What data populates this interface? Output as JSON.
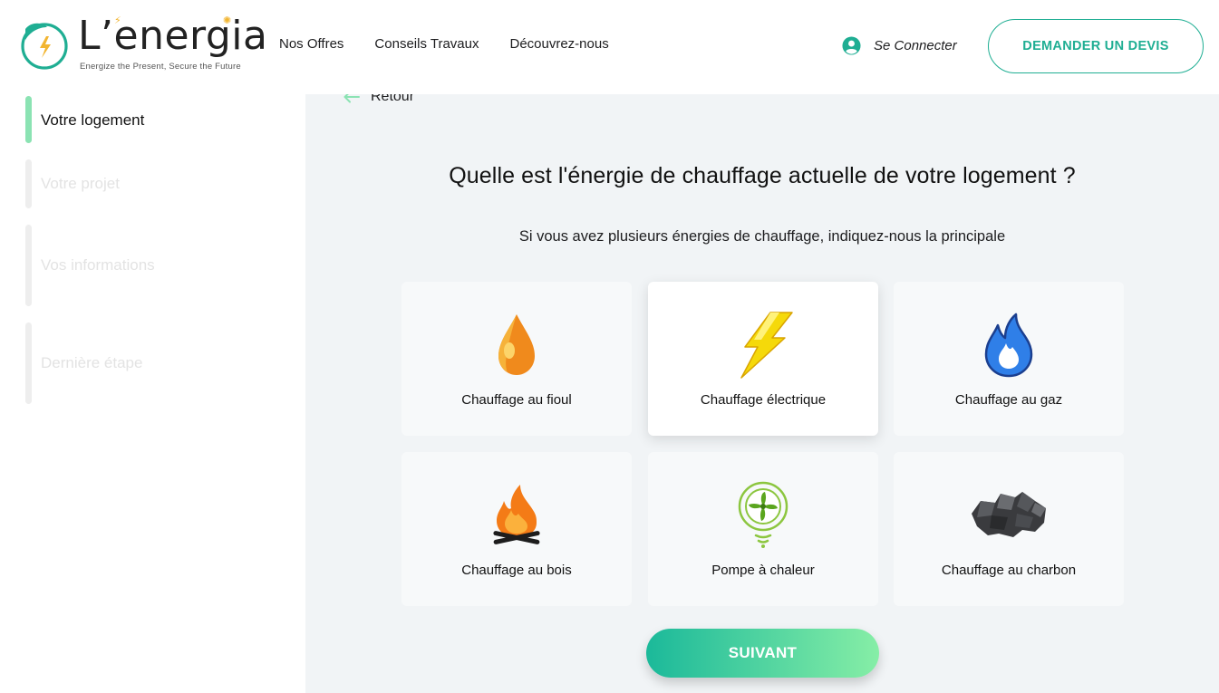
{
  "brand": {
    "name": "L’energia",
    "tagline": "Energize the Present, Secure the Future"
  },
  "nav": {
    "items": [
      "Nos Offres",
      "Conseils Travaux",
      "Découvrez-nous"
    ]
  },
  "account": {
    "login_label": "Se Connecter",
    "devis_label": "DEMANDER UN DEVIS"
  },
  "steps": [
    {
      "label": "Votre logement",
      "active": true
    },
    {
      "label": "Votre projet",
      "active": false
    },
    {
      "label": "Vos informations",
      "active": false
    },
    {
      "label": "Dernière étape",
      "active": false
    }
  ],
  "main": {
    "back_label": "Retour",
    "question": "Quelle est l'énergie de chauffage actuelle de votre logement ?",
    "subtitle": "Si vous avez plusieurs énergies de chauffage, indiquez-nous la principale",
    "options": [
      {
        "label": "Chauffage au fioul",
        "icon": "oil-drop-icon",
        "selected": false
      },
      {
        "label": "Chauffage électrique",
        "icon": "lightning-bolt-icon",
        "selected": true
      },
      {
        "label": "Chauffage au gaz",
        "icon": "gas-flame-icon",
        "selected": false
      },
      {
        "label": "Chauffage au bois",
        "icon": "campfire-icon",
        "selected": false
      },
      {
        "label": "Pompe à chaleur",
        "icon": "heat-pump-icon",
        "selected": false
      },
      {
        "label": "Chauffage au charbon",
        "icon": "coal-icon",
        "selected": false
      }
    ],
    "next_label": "SUIVANT"
  },
  "colors": {
    "accent": "#1fae93",
    "step_active": "#8be3b3",
    "main_bg": "#f1f4f6"
  }
}
